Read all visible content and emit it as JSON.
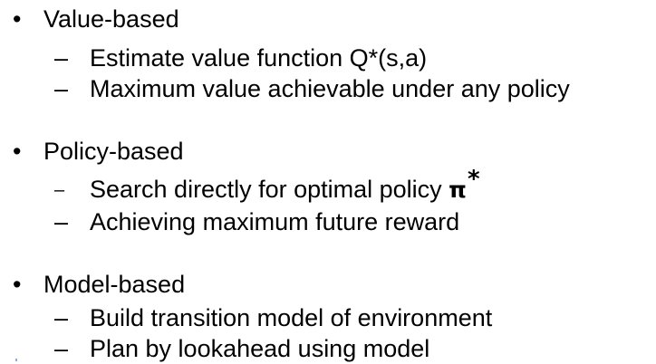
{
  "sections": [
    {
      "heading": "Value-based",
      "items": [
        "Estimate value function Q*(s,a)",
        "Maximum value achievable under any policy"
      ]
    },
    {
      "heading": "Policy-based",
      "items": [
        {
          "text": "Search directly for optimal policy ",
          "symbol": "π",
          "sup": "*"
        },
        "Achieving maximum future reward"
      ]
    },
    {
      "heading": "Model-based",
      "items": [
        "Build transition model of environment",
        "Plan by lookahead using model"
      ]
    }
  ],
  "bullet_glyph": "•",
  "dash_glyph": "–"
}
